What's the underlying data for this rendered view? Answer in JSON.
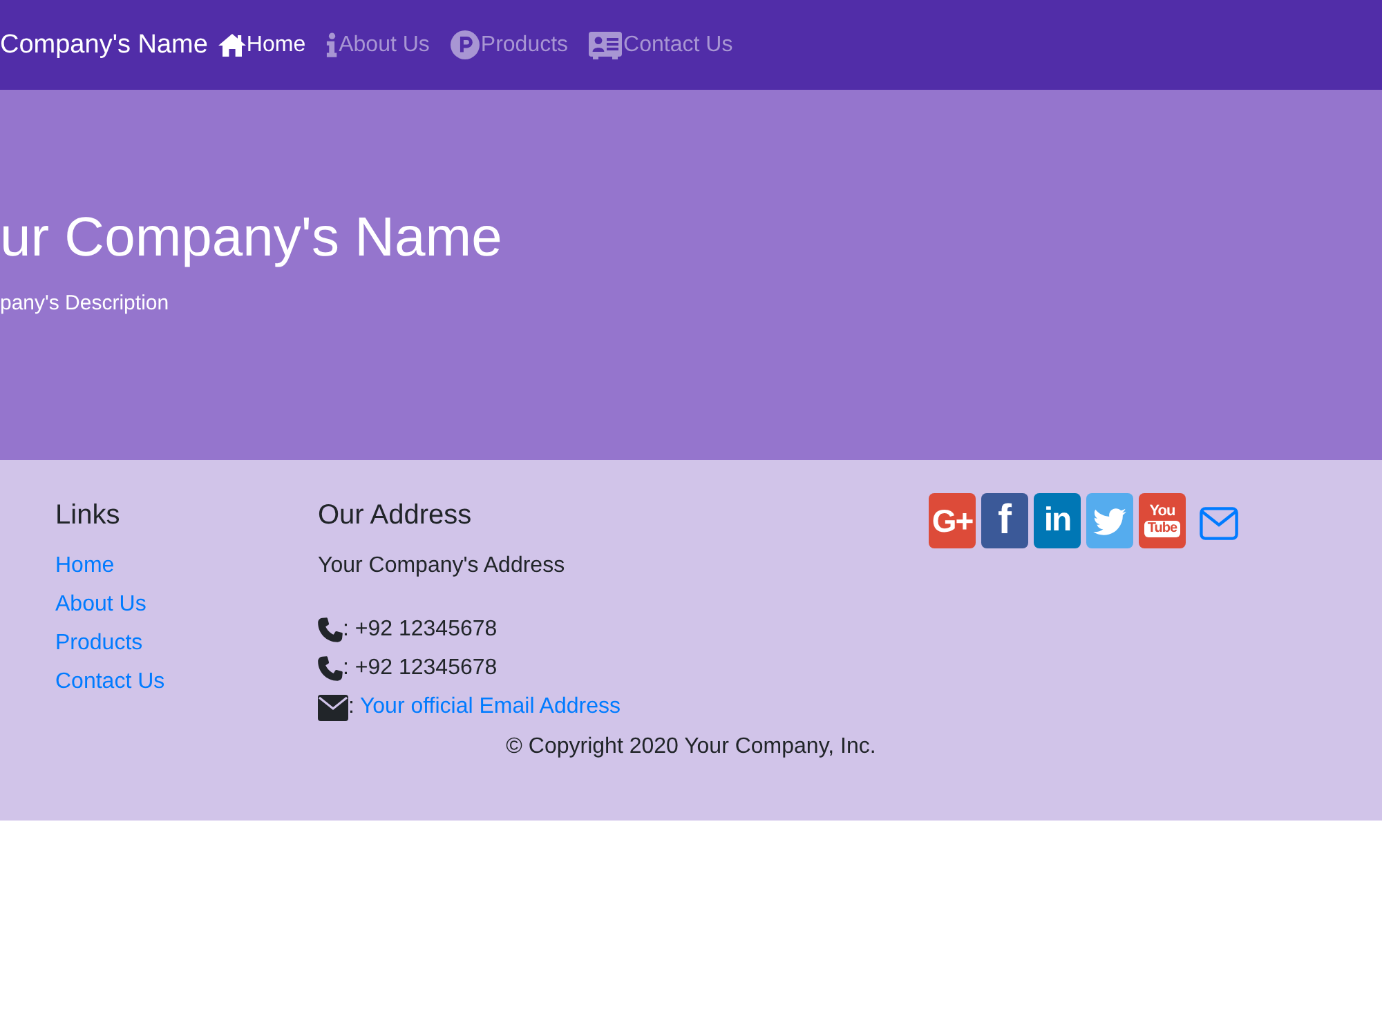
{
  "navbar": {
    "brand": "Company's Name",
    "items": [
      {
        "label": "Home",
        "selected": true
      },
      {
        "label": "About Us",
        "selected": false
      },
      {
        "label": "Products",
        "selected": false
      },
      {
        "label": "Contact Us",
        "selected": false
      }
    ]
  },
  "hero": {
    "title": "ur Company's Name",
    "description": "pany's Description"
  },
  "footer": {
    "links": {
      "heading": "Links",
      "items": [
        "Home",
        "About Us",
        "Products",
        "Contact Us"
      ]
    },
    "address": {
      "heading": "Our Address",
      "address": "Your Company's Address",
      "contacts": [
        {
          "kind": "phone",
          "text": ": +92 12345678"
        },
        {
          "kind": "phone",
          "text": ": +92 12345678"
        },
        {
          "kind": "email",
          "text": ":",
          "link": "Your official Email Address"
        }
      ]
    },
    "social": [
      {
        "kind": "text",
        "text": "G+",
        "color": "#dd4b39"
      },
      {
        "kind": "text",
        "text": "f",
        "color": "#3b5998"
      },
      {
        "kind": "text",
        "text": "in",
        "color": "#0077b5"
      },
      {
        "kind": "bird",
        "color": "#55acee"
      },
      {
        "kind": "stacked",
        "lines": [
          "You",
          "Tube"
        ],
        "color": "#dd4b39"
      },
      {
        "kind": "mail"
      }
    ],
    "copyright": "© Copyright 2020 Your Company, Inc."
  }
}
